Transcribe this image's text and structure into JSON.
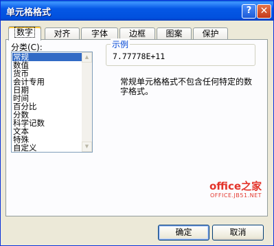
{
  "window": {
    "title": "单元格格式",
    "help_label": "?",
    "close_label": "✕"
  },
  "tabs": [
    "数字",
    "对齐",
    "字体",
    "边框",
    "图案",
    "保护"
  ],
  "category": {
    "label": "分类(C):",
    "items": [
      "常规",
      "数值",
      "货币",
      "会计专用",
      "日期",
      "时间",
      "百分比",
      "分数",
      "科学记数",
      "文本",
      "特殊",
      "自定义"
    ],
    "selected": "常规"
  },
  "sample": {
    "label": "示例",
    "value": "7.77778E+11"
  },
  "description": "常规单元格格式不包含任何特定的数字格式。",
  "watermark": {
    "logo": "office之家",
    "url": "OFFICE.JB51.NET"
  },
  "buttons": {
    "ok": "确定",
    "cancel": "取消"
  }
}
